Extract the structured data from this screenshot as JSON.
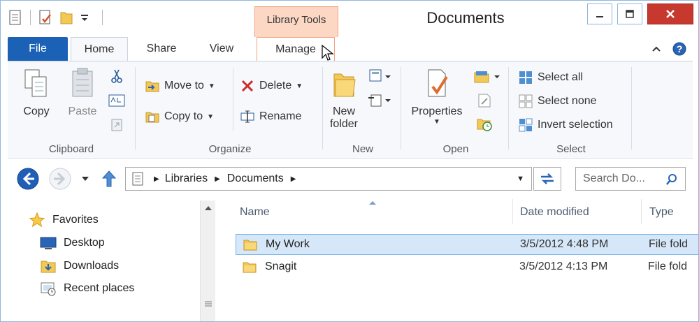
{
  "window": {
    "title": "Documents"
  },
  "context_tab": {
    "group_label": "Library Tools"
  },
  "tabs": {
    "file": "File",
    "home": "Home",
    "share": "Share",
    "view": "View",
    "manage": "Manage"
  },
  "ribbon": {
    "clipboard": {
      "label": "Clipboard",
      "copy": "Copy",
      "paste": "Paste"
    },
    "organize": {
      "label": "Organize",
      "move_to": "Move to",
      "copy_to": "Copy to",
      "delete": "Delete",
      "rename": "Rename"
    },
    "new": {
      "label": "New",
      "new_folder_line1": "New",
      "new_folder_line2": "folder"
    },
    "open": {
      "label": "Open",
      "properties": "Properties"
    },
    "select": {
      "label": "Select",
      "select_all": "Select all",
      "select_none": "Select none",
      "invert_selection": "Invert selection"
    }
  },
  "address": {
    "segments": [
      "Libraries",
      "Documents"
    ]
  },
  "search": {
    "placeholder": "Search Do..."
  },
  "nav_pane": {
    "favorites": "Favorites",
    "items": [
      {
        "label": "Desktop",
        "icon": "desktop-icon"
      },
      {
        "label": "Downloads",
        "icon": "downloads-icon"
      },
      {
        "label": "Recent places",
        "icon": "recent-places-icon"
      }
    ]
  },
  "columns": {
    "name": "Name",
    "date_modified": "Date modified",
    "type": "Type"
  },
  "files": [
    {
      "name": "My Work",
      "date": "3/5/2012 4:48 PM",
      "type": "File fold",
      "selected": true
    },
    {
      "name": "Snagit",
      "date": "3/5/2012 4:13 PM",
      "type": "File fold",
      "selected": false
    }
  ],
  "colors": {
    "accent": "#1b62b6",
    "context_tab": "#fcd8c4",
    "selection": "#d5e7f8"
  }
}
